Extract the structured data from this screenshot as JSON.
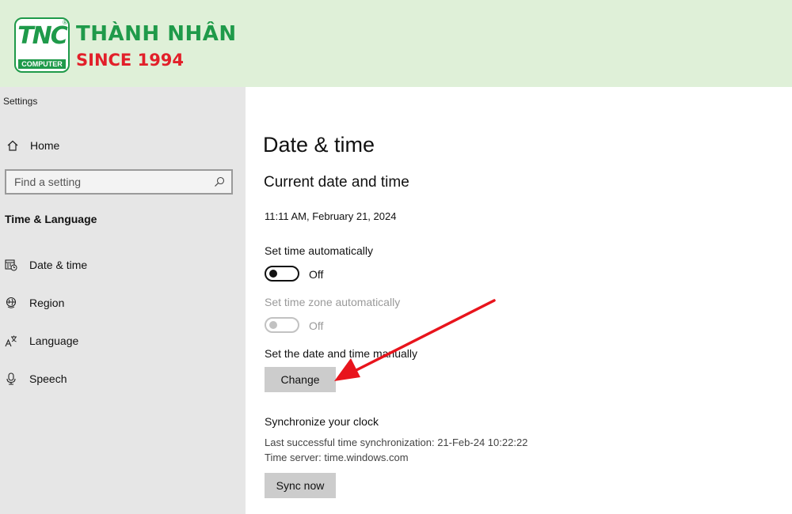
{
  "banner": {
    "logo_text": "TNC",
    "logo_sub": "COMPUTER",
    "logo_reg": "®",
    "brand_name": "THÀNH NHÂN",
    "since": "SINCE 1994"
  },
  "window": {
    "title": "Settings"
  },
  "sidebar": {
    "home": {
      "label": "Home",
      "icon": "home-icon"
    },
    "search": {
      "placeholder": "Find a setting",
      "icon": "search-icon"
    },
    "section": "Time & Language",
    "items": [
      {
        "label": "Date & time",
        "icon": "calendar-clock-icon"
      },
      {
        "label": "Region",
        "icon": "globe-icon"
      },
      {
        "label": "Language",
        "icon": "language-icon"
      },
      {
        "label": "Speech",
        "icon": "microphone-icon"
      }
    ]
  },
  "main": {
    "title": "Date & time",
    "current_heading": "Current date and time",
    "current_value": "11:11 AM, February 21, 2024",
    "auto_time": {
      "label": "Set time automatically",
      "state": "Off",
      "enabled": true,
      "on": false
    },
    "auto_zone": {
      "label": "Set time zone automatically",
      "state": "Off",
      "enabled": false,
      "on": false
    },
    "manual": {
      "label": "Set the date and time manually",
      "button": "Change"
    },
    "sync": {
      "heading": "Synchronize your clock",
      "last_sync": "Last successful time synchronization: 21-Feb-24 10:22:22",
      "server": "Time server: time.windows.com",
      "button": "Sync now"
    }
  },
  "colors": {
    "banner_bg": "#dff0d8",
    "brand_green": "#1f9a4a",
    "brand_red": "#e2202a",
    "sidebar_bg": "#e6e6e6",
    "button_bg": "#cccccc",
    "arrow": "#e8141c"
  }
}
